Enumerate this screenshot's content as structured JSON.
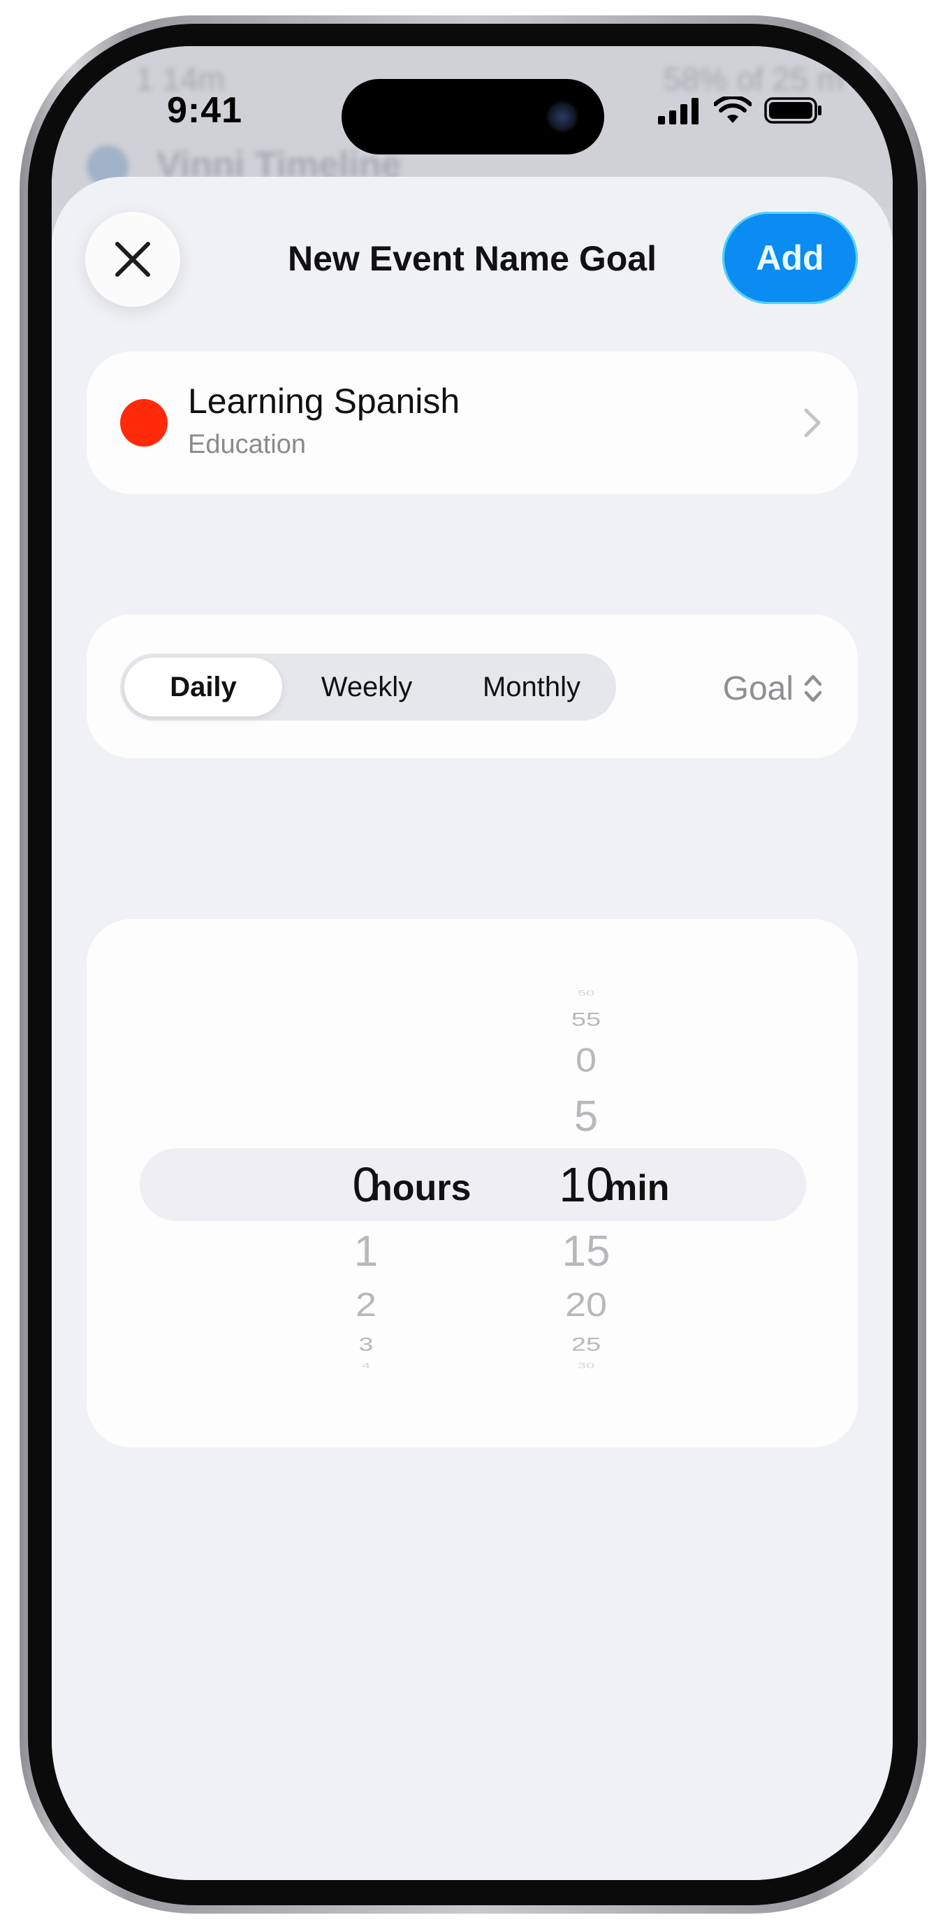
{
  "status_bar": {
    "time": "9:41"
  },
  "background_app": {
    "left_text": "1 14m",
    "right_text": "58% of 25 m",
    "row_title": "Vinni Timeline"
  },
  "sheet": {
    "title": "New Event Name Goal",
    "add_label": "Add"
  },
  "category": {
    "name": "Learning Spanish",
    "subtitle": "Education",
    "color": "#ff2a0a"
  },
  "period": {
    "options": [
      "Daily",
      "Weekly",
      "Monthly"
    ],
    "selected": "Daily",
    "goal_label": "Goal"
  },
  "time_picker": {
    "hours_selected": "0",
    "hours_unit": "hours",
    "hours_after": [
      "1",
      "2",
      "3",
      "4"
    ],
    "minutes_selected": "10",
    "minutes_unit": "min",
    "minutes_before": [
      "50",
      "55",
      "0",
      "5"
    ],
    "minutes_after": [
      "15",
      "20",
      "25",
      "30"
    ]
  },
  "colors": {
    "accent": "#0a8cf3",
    "sheet_bg": "#f0f1f5"
  }
}
